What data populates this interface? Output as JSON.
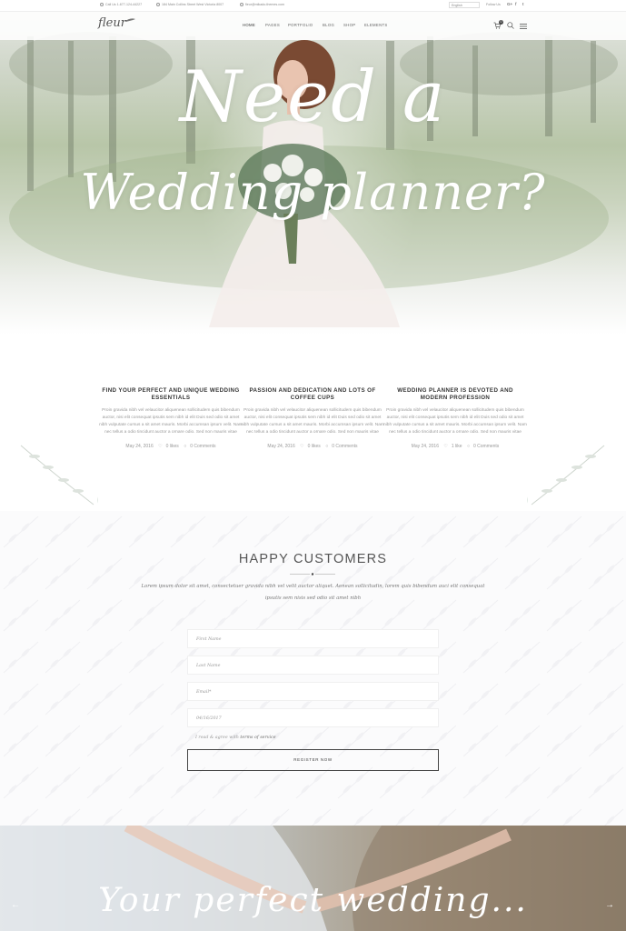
{
  "topbar": {
    "phone": "Call Us 1-677-124-44227",
    "address": "184 Main Collins Street West Victoria 8007",
    "email": "fleur@mikado-themes.com",
    "language": "English",
    "follow": "Follow Us",
    "social": [
      "G+",
      "f",
      "t"
    ]
  },
  "header": {
    "logo": "fleur",
    "nav": [
      "HOME",
      "PAGES",
      "PORTFOLIO",
      "BLOG",
      "SHOP",
      "ELEMENTS"
    ],
    "cart_count": "0"
  },
  "hero": {
    "line1": "Need a",
    "line2": "Wedding planner?"
  },
  "posts": [
    {
      "title": "FIND YOUR PERFECT AND UNIQUE WEDDING ESSENTIALS",
      "excerpt": "Proin gravida nibh vel velaucitor aliquenean sollicitudem quis bibendum auctor, nisi elit consequat ipsutis sem nibh id elit Duis sed odio sit amet nibh vulputate cursus a sit amet mauris. Morbi accumsan ipsum velit. Nam nec tellus a odio tincidunt auctor a ornare odio. Sed non mauris vitae",
      "date": "May 24, 2016",
      "likes": "0 likes",
      "comments": "0 Comments"
    },
    {
      "title": "PASSION AND DEDICATION AND LOTS OF COFFEE CUPS",
      "excerpt": "Proin gravida nibh vel velaucitor aliquenean sollicitudem quis bibendum auctor, nisi elit consequat ipsutis sem nibh id elit Duis sed odio sit amet nibh vulputate cursus a sit amet mauris. Morbi accumsan ipsum velit. Nam nec tellus a odio tincidunt auctor a ornare odio. Sed non mauris vitae",
      "date": "May 24, 2016",
      "likes": "0 likes",
      "comments": "0 Comments"
    },
    {
      "title": "WEDDING PLANNER IS DEVOTED AND MODERN PROFESSION",
      "excerpt": "Proin gravida nibh vel velaucitor aliquenean sollicitudem quis bibendum auctor, nisi elit consequat ipsutis sem nibh id elit Duis sed odio sit amet nibh vulputate cursus a sit amet mauris. Morbi accumsan ipsum velit. Nam nec tellus a odio tincidunt auctor a ornare odio. Sed non mauris vitae",
      "date": "May 24, 2016",
      "likes": "1 like",
      "comments": "0 Comments"
    }
  ],
  "customers": {
    "title": "HAPPY CUSTOMERS",
    "text": "Lorem ipsum dolor sit amet, consectetuer gravida nibh vel velit auctor aliquet. Aenean sollicitudin, lorem quis bibendum auci elit consequat ipsutis sem nisis sed odio sit amet nibh",
    "fields": {
      "first_name": "First Name",
      "last_name": "Last Name",
      "email": "Email*",
      "date": "04/16/2017"
    },
    "agree_text": "I read & agree with",
    "agree_link": "terms of service",
    "submit": "REGISTER NOW"
  },
  "bottom": {
    "title": "Your perfect wedding..."
  },
  "colors": {
    "accent": "#444444",
    "text": "#555555",
    "muted": "#999999"
  }
}
